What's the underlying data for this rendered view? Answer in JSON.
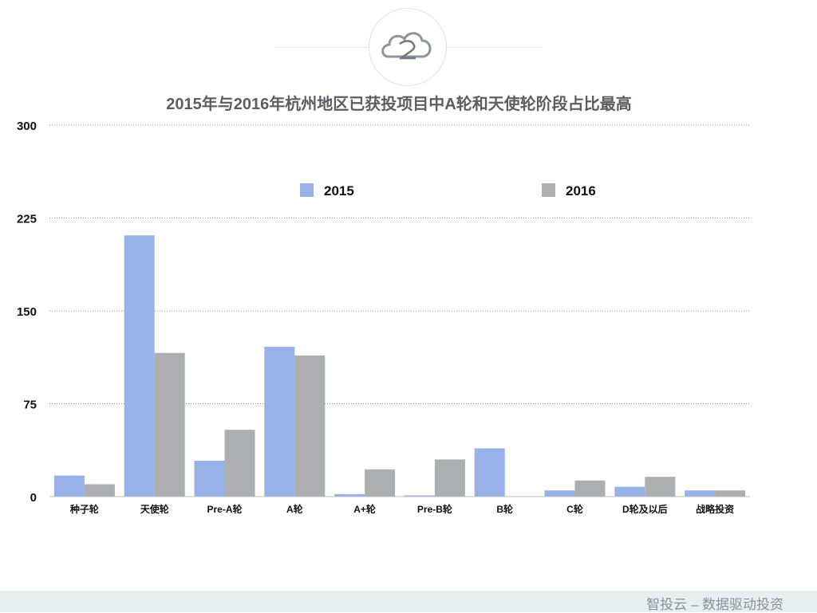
{
  "logo": {
    "name": "zhi-tou-yun-logo"
  },
  "title": "2015年与2016年杭州地区已获投项目中A轮和天使轮阶段占比最高",
  "footer": {
    "text": "智投云 – 数据驱动投资"
  },
  "colors": {
    "series_2015": "#99b1e9",
    "series_2016": "#acaeb0",
    "gridline": "#8c8c8c",
    "footer_bg": "#e9eef1"
  },
  "chart_data": {
    "type": "bar",
    "title": "2015年与2016年杭州地区已获投项目中A轮和天使轮阶段占比最高",
    "categories": [
      "种子轮",
      "天使轮",
      "Pre-A轮",
      "A轮",
      "A+轮",
      "Pre-B轮",
      "B轮",
      "C轮",
      "D轮及以后",
      "战略投资"
    ],
    "series": [
      {
        "name": "2015",
        "color": "#99b1e9",
        "values": [
          17,
          211,
          29,
          121,
          2,
          1,
          39,
          5,
          8,
          5
        ]
      },
      {
        "name": "2016",
        "color": "#acaeb0",
        "values": [
          10,
          116,
          54,
          114,
          22,
          30,
          0,
          13,
          16,
          5
        ]
      }
    ],
    "yticks": [
      0,
      75,
      150,
      225,
      300
    ],
    "ylim": [
      0,
      300
    ],
    "xlabel": "",
    "ylabel": "",
    "grid": true,
    "legend": "top-center"
  }
}
